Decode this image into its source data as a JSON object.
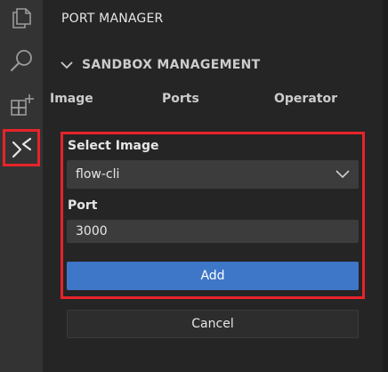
{
  "sidebar": {
    "title": "PORT MANAGER"
  },
  "activity_bar": {
    "icons": [
      "explorer-icon",
      "search-icon",
      "extensions-icon",
      "port-manager-icon"
    ],
    "active": "port-manager-icon",
    "highlight_color": "#e8232a"
  },
  "section": {
    "title": "SANDBOX MANAGEMENT",
    "expanded": true
  },
  "tabs": [
    {
      "label": "Image"
    },
    {
      "label": "Ports"
    },
    {
      "label": "Operator"
    }
  ],
  "form": {
    "select_image_label": "Select Image",
    "select_image_value": "flow-cli",
    "port_label": "Port",
    "port_value": "3000",
    "add_label": "Add",
    "cancel_label": "Cancel"
  },
  "colors": {
    "accent": "#3e76c8",
    "highlight": "#e8232a",
    "background": "#252526",
    "input_bg": "#3c3c3c"
  }
}
